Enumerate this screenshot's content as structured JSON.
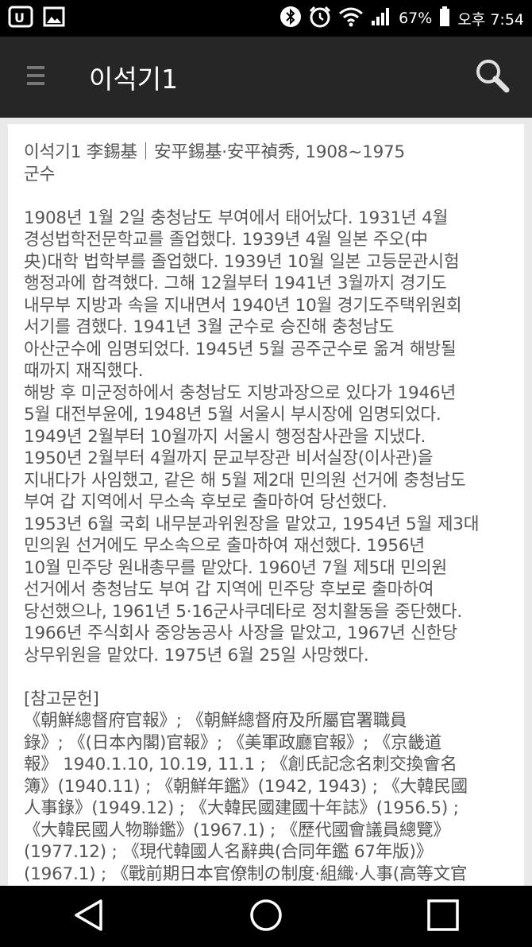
{
  "status_bar": {
    "battery_percent": "67%",
    "time": "오후 7:54",
    "icons": [
      "app-icon",
      "gallery-icon",
      "bluetooth-icon",
      "alarm-icon",
      "wifi-icon",
      "signal-icon",
      "battery-icon"
    ]
  },
  "app_bar": {
    "title": "이석기1",
    "menu_icon": "menu-icon",
    "search_icon": "search-icon"
  },
  "article": {
    "header_line1": "이석기1 李錫基｜安平錫基·安平禎秀, 1908~1975",
    "header_line2": "군수",
    "body": "1908년 1월 2일 충청남도 부여에서 태어났다. 1931년 4월\n경성법학전문학교를 졸업했다. 1939년 4월 일본 주오(中\n央)대학 법학부를 졸업했다. 1939년 10월 일본 고등문관시험\n행정과에 합격했다. 그해 12월부터 1941년 3월까지 경기도\n내무부 지방과 속을 지내면서 1940년 10월 경기도주택위원회\n서기를 겸했다. 1941년 3월 군수로 승진해 충청남도\n아산군수에 임명되었다. 1945년 5월 공주군수로 옮겨 해방될\n때까지 재직했다.\n해방 후 미군정하에서 충청남도 지방과장으로 있다가 1946년\n5월 대전부윤에, 1948년 5월 서울시 부시장에 임명되었다.\n1949년 2월부터 10월까지 서울시 행정참사관을 지냈다.\n1950년 2월부터 4월까지 문교부장관 비서실장(이사관)을\n지내다가 사임했고, 같은 해 5월 제2대 민의원 선거에 충청남도\n부여 갑 지역에서 무소속 후보로 출마하여 당선했다.\n1953년 6월 국회 내무분과위원장을 맡았고, 1954년 5월 제3대\n민의원 선거에도 무소속으로 출마하여 재선했다. 1956년\n10월 민주당 원내총무를 맡았다. 1960년 7월 제5대 민의원\n선거에서 충청남도 부여 갑 지역에 민주당 후보로 출마하여\n당선했으나, 1961년 5·16군사쿠데타로 정치활동을 중단했다.\n1966년 주식회사 중앙농공사 사장을 맡았고, 1967년 신한당\n상무위원을 맡았다. 1975년 6월 25일 사망했다.",
    "references_heading": "[참고문헌]",
    "references": "《朝鮮總督府官報》; 《朝鮮總督府及所屬官署職員\n錄》; 《(日本內閣)官報》; 《美軍政廳官報》; 《京畿道\n報》 1940.1.10, 10.19, 11.1 ; 《創氏記念名刺交換會名\n簿》(1940.11) ; 《朝鮮年鑑》(1942, 1943) ; 《大韓民國\n人事錄》(1949.12) ; 《大韓民國建國十年誌》(1956.5) ;\n《大韓民國人物聯鑑》(1967.1) ; 《歷代國會議員總覽》\n(1977.12) ; 《現代韓國人名辭典(合同年鑑 67年版)》\n(1967.1) ; 《戰前期日本官僚制の制度·組織·人事(高等文官"
  },
  "nav_bar": {
    "back_icon": "back-icon",
    "home_icon": "home-icon",
    "recents_icon": "recents-icon"
  }
}
